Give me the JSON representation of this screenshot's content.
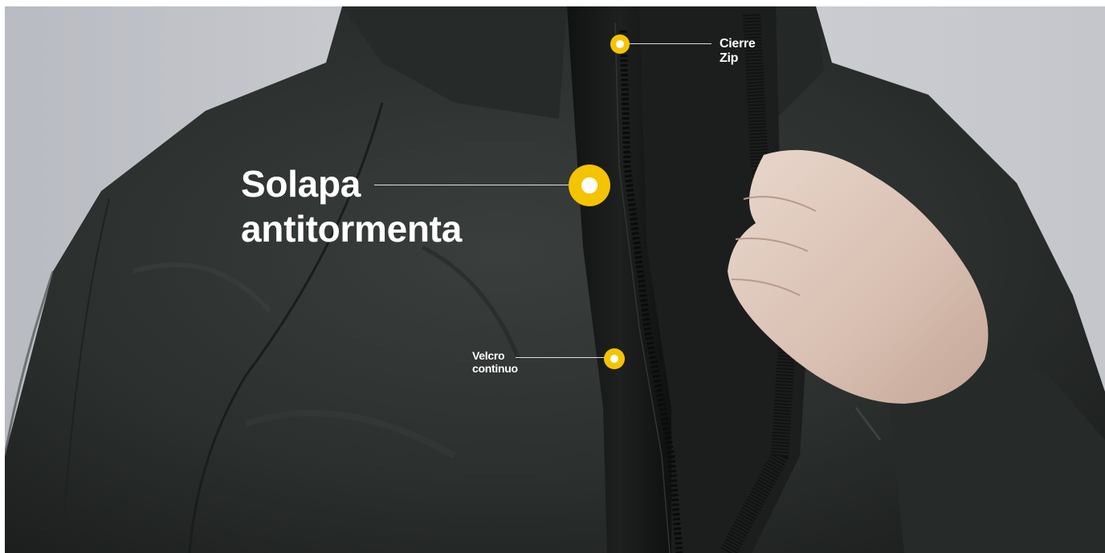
{
  "colors": {
    "accent": "#F5C400",
    "label": "#FFFFFF",
    "background": "#C9CBD0",
    "jacket": "#2A2D2C"
  },
  "hotspots": {
    "zip": {
      "label": "Cierre Zip",
      "icon": "hotspot-dot-icon"
    },
    "storm_flap": {
      "label_line1": "Solapa",
      "label_line2": "antitormenta",
      "icon": "hotspot-dot-icon"
    },
    "velcro": {
      "label_line1": "Velcro",
      "label_line2": "continuo",
      "icon": "hotspot-dot-icon"
    }
  }
}
